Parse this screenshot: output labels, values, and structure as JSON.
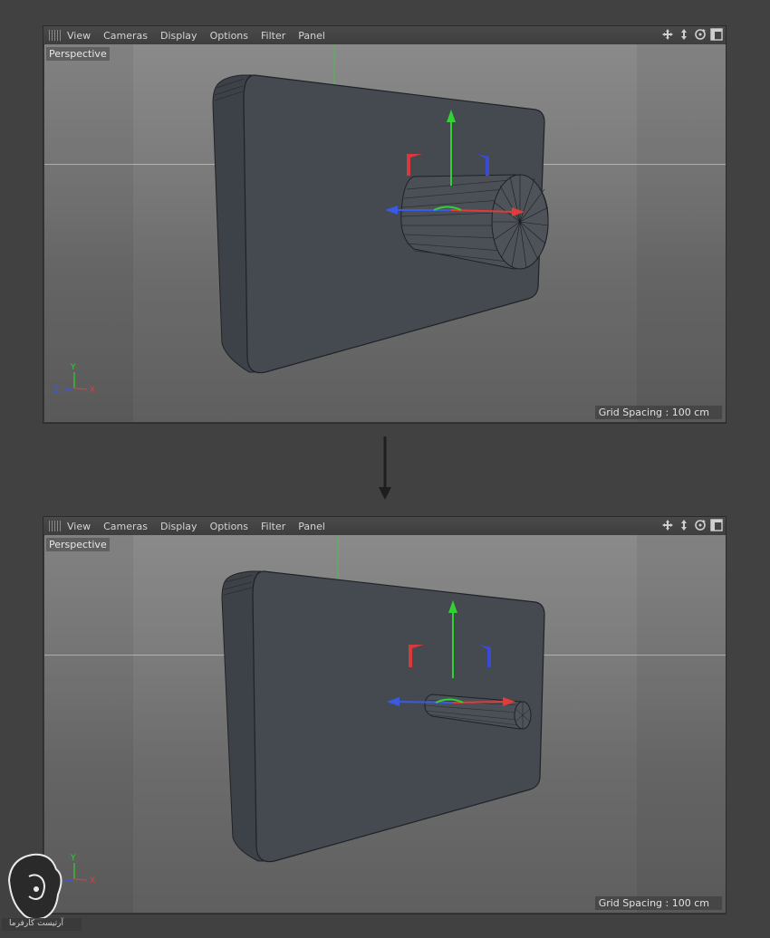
{
  "menu": {
    "items": [
      "View",
      "Cameras",
      "Display",
      "Options",
      "Filter",
      "Panel"
    ]
  },
  "viewports": [
    {
      "label": "Perspective",
      "grid_spacing": "Grid Spacing : 100 cm"
    },
    {
      "label": "Perspective",
      "grid_spacing": "Grid Spacing : 100 cm"
    }
  ],
  "axis_labels": {
    "y": "Y",
    "z": "Z",
    "x": "X"
  },
  "colors": {
    "axis_x": "#e03b3b",
    "axis_y": "#3bd83b",
    "axis_z": "#3b5be0",
    "object_fill": "#454a50",
    "background": "#414141"
  },
  "icons": [
    "move-view-icon",
    "dolly-view-icon",
    "rotate-view-icon",
    "toggle-layout-icon"
  ],
  "watermark": {
    "text": "آرتیست کارفرما"
  }
}
